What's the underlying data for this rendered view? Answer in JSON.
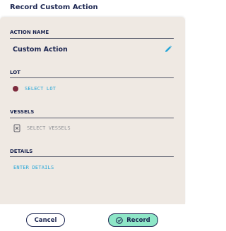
{
  "dialog": {
    "title": "Record Custom Action"
  },
  "sections": {
    "action_name": {
      "label": "ACTION NAME",
      "value": "Custom Action",
      "icon": "pencil-icon"
    },
    "lot": {
      "label": "LOT",
      "action_text": "SELECT LOT",
      "dot_color": "#7d2b3d"
    },
    "vessels": {
      "label": "VESSELS",
      "action_text": "SELECT VESSELS",
      "icon": "vessel-icon"
    },
    "details": {
      "label": "DETAILS",
      "action_text": "ENTER DETAILS"
    }
  },
  "footer": {
    "cancel_label": "Cancel",
    "record_label": "Record",
    "record_icon": "check-circle-icon"
  },
  "colors": {
    "navy": "#1b2550",
    "accent_blue": "#26a6d8",
    "record_green": "#8ee6c7",
    "panel_bg": "#efe9e3"
  }
}
